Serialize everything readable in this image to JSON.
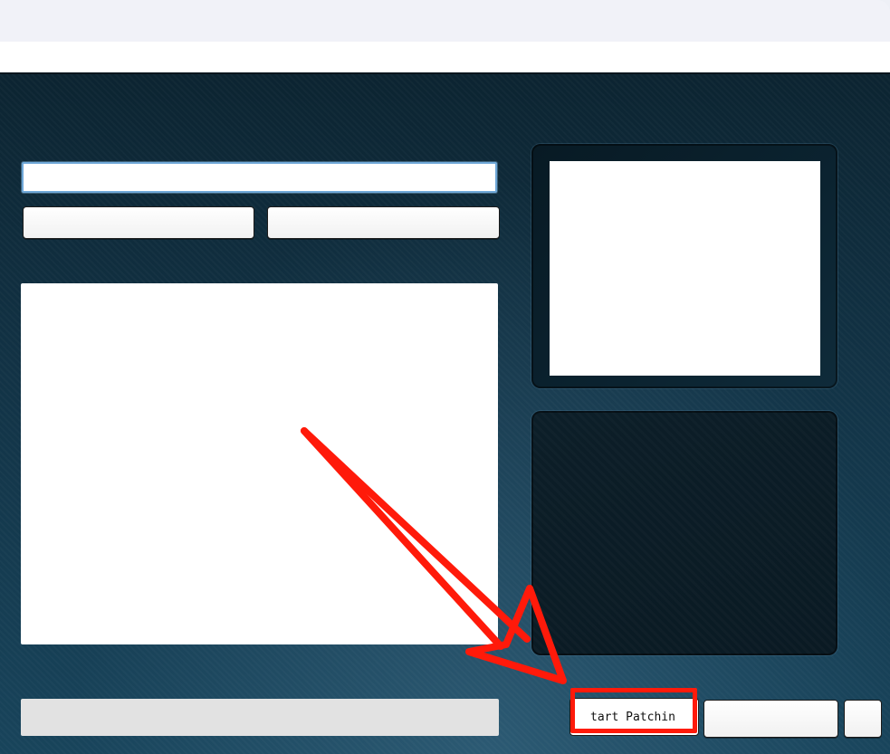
{
  "app": {
    "start_button_label": "tart Patchin"
  },
  "progress": {
    "value": 0
  },
  "annotation": {
    "color": "#ff1a0a"
  },
  "icons": {
    "arrow": "red-arrow-annotation"
  }
}
